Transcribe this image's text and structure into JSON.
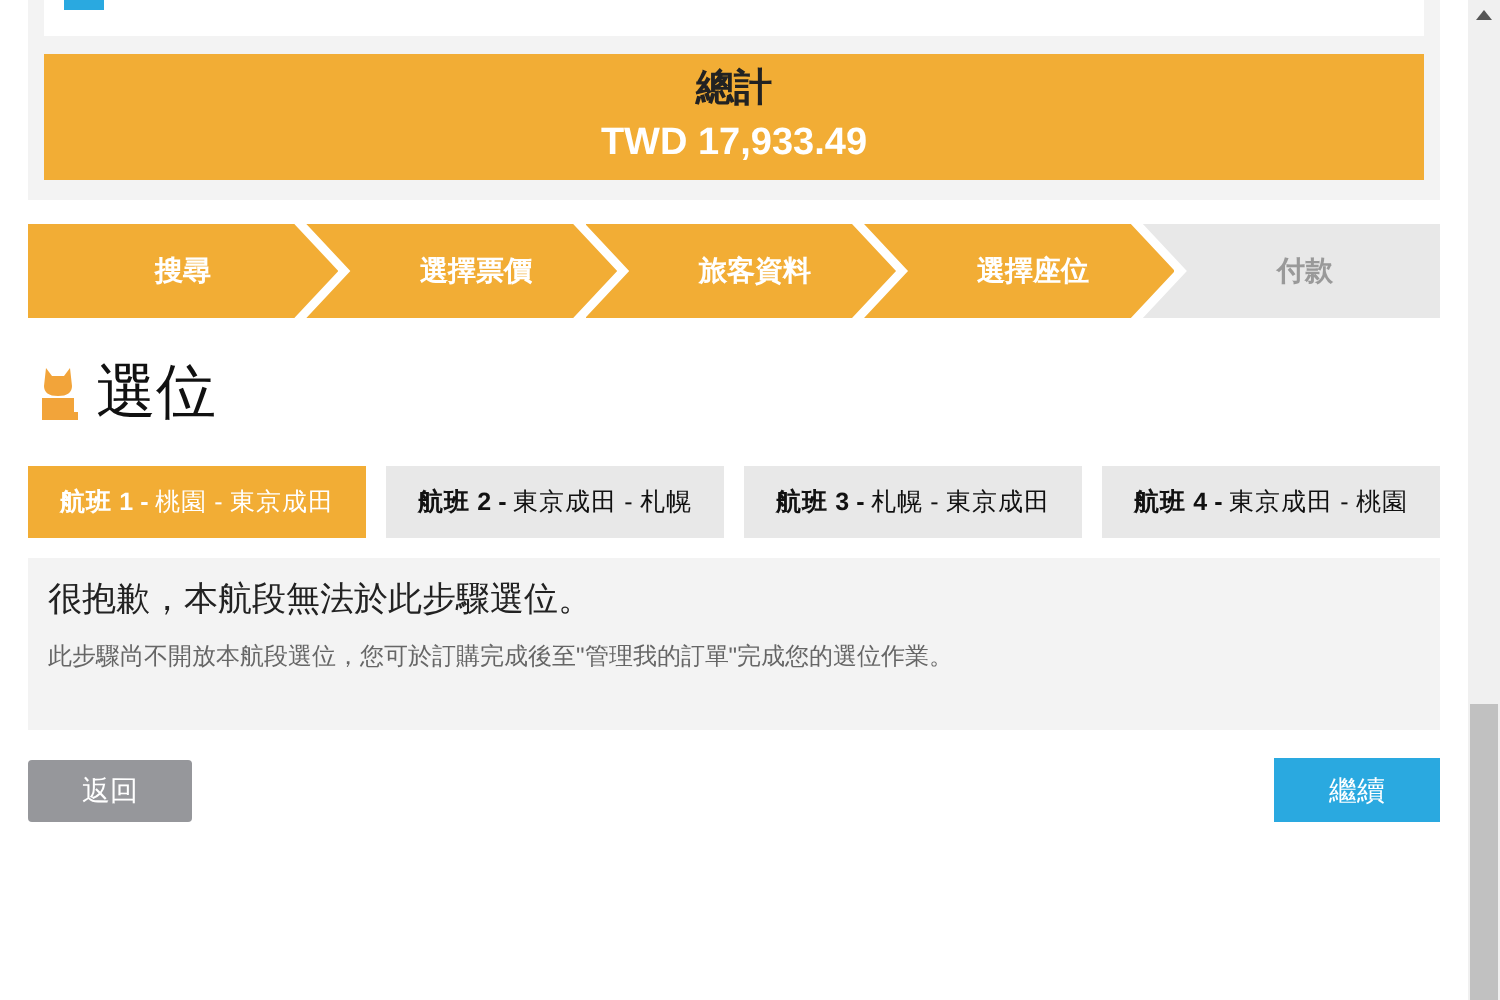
{
  "total": {
    "label": "總計",
    "amount": "TWD 17,933.49"
  },
  "steps": [
    {
      "label": "搜尋",
      "done": true
    },
    {
      "label": "選擇票價",
      "done": true
    },
    {
      "label": "旅客資料",
      "done": true
    },
    {
      "label": "選擇座位",
      "done": true
    },
    {
      "label": "付款",
      "done": false
    }
  ],
  "heading": "選位",
  "flight_tabs": [
    {
      "label": "**航班 1 -** 桃園 - 東京成田",
      "selected": true
    },
    {
      "label": "**航班 2 -** 東京成田 - 札幌",
      "selected": false
    },
    {
      "label": "**航班 3 -** 札幌 - 東京成田",
      "selected": false
    },
    {
      "label": "**航班 4 -** 東京成田 - 桃園",
      "selected": false
    }
  ],
  "notice": {
    "title": "很抱歉，本航段無法於此步驟選位。",
    "text": "此步驟尚不開放本航段選位，您可於訂購完成後至\"管理我的訂單\"完成您的選位作業。"
  },
  "buttons": {
    "back": "返回",
    "next": "繼續"
  }
}
